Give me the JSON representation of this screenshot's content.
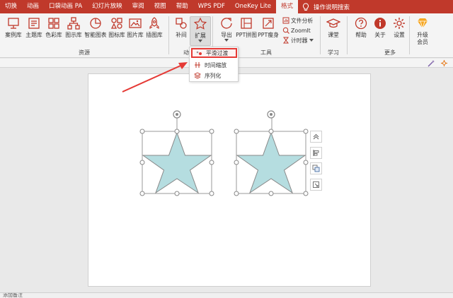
{
  "menubar": {
    "items": [
      "切换",
      "动画",
      "口袋动画 PA",
      "幻灯片放映",
      "审阅",
      "视图",
      "帮助",
      "WPS PDF",
      "OneKey Lite",
      "格式"
    ],
    "active_index": 9,
    "help_text": "操作说明搜索",
    "accent_color": "#c0392b"
  },
  "ribbon": {
    "resources": {
      "label": "资源",
      "buttons": [
        "案例库",
        "主题库",
        "色彩库",
        "图示库",
        "智能图表",
        "图标库",
        "图片库",
        "插图库"
      ]
    },
    "animation": {
      "label": "动",
      "buttons": [
        "补间",
        "扩展"
      ]
    },
    "tools": {
      "label": "工具",
      "buttons": [
        "导出",
        "PPT拼图",
        "PPT瘦身"
      ],
      "small_buttons": [
        "文件分析",
        "ZoomIt",
        "计时器"
      ]
    },
    "learn": {
      "label": "学习",
      "buttons": [
        "课堂"
      ]
    },
    "more": {
      "label": "更多",
      "buttons": [
        "帮助",
        "关于",
        "设置",
        "升级\n会员"
      ]
    }
  },
  "dropdown": {
    "items": [
      "平滑过渡",
      "时间缩放",
      "序列化"
    ],
    "highlight_index": 0,
    "highlight_color": "#e53935"
  },
  "shape": {
    "fill_color": "#b5dde0",
    "stroke_color": "#888888"
  },
  "status": {
    "text": "添加备注"
  }
}
